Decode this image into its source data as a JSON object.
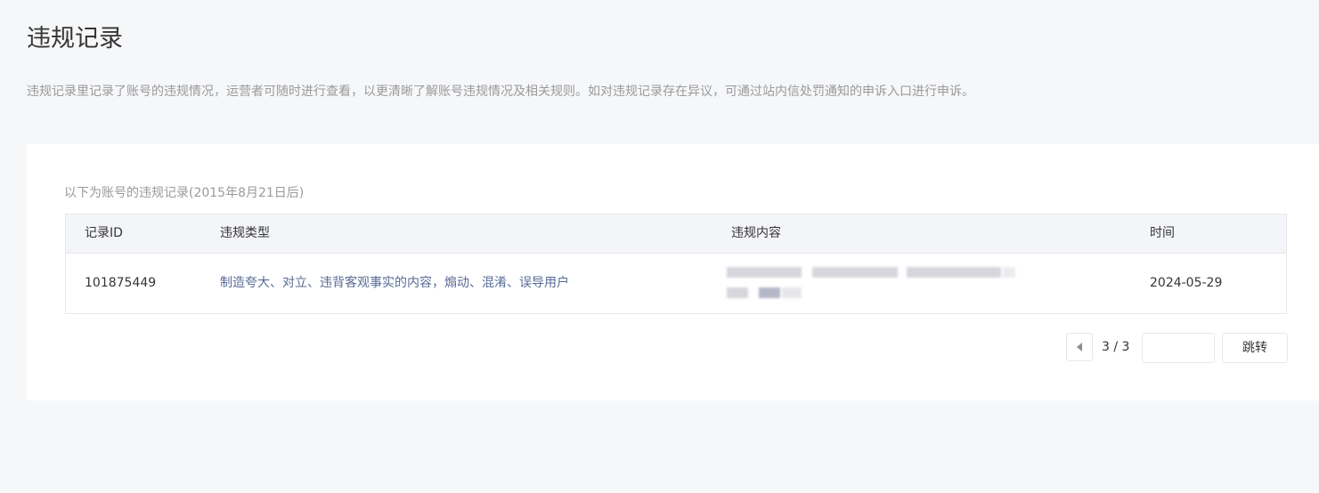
{
  "page": {
    "title": "违规记录",
    "description": "违规记录里记录了账号的违规情况，运营者可随时进行查看，以更清晰了解账号违规情况及相关规则。如对违规记录存在异议，可通过站内信处罚通知的申诉入口进行申诉。"
  },
  "records": {
    "caption": "以下为账号的违规记录(2015年8月21日后)",
    "columns": [
      "记录ID",
      "违规类型",
      "违规内容",
      "时间"
    ],
    "rows": [
      {
        "id": "101875449",
        "type": "制造夸大、对立、违背客观事实的内容，煽动、混淆、误导用户",
        "content": "",
        "time": "2024-05-29"
      }
    ]
  },
  "pager": {
    "page_text": "3 / 3",
    "input_value": "",
    "jump_label": "跳转",
    "prev_icon": "chevron-left-icon"
  },
  "colors": {
    "background": "#f6f7f9",
    "link": "#576b95",
    "muted_text": "#9a9a9a",
    "border": "#e4e8eb"
  }
}
